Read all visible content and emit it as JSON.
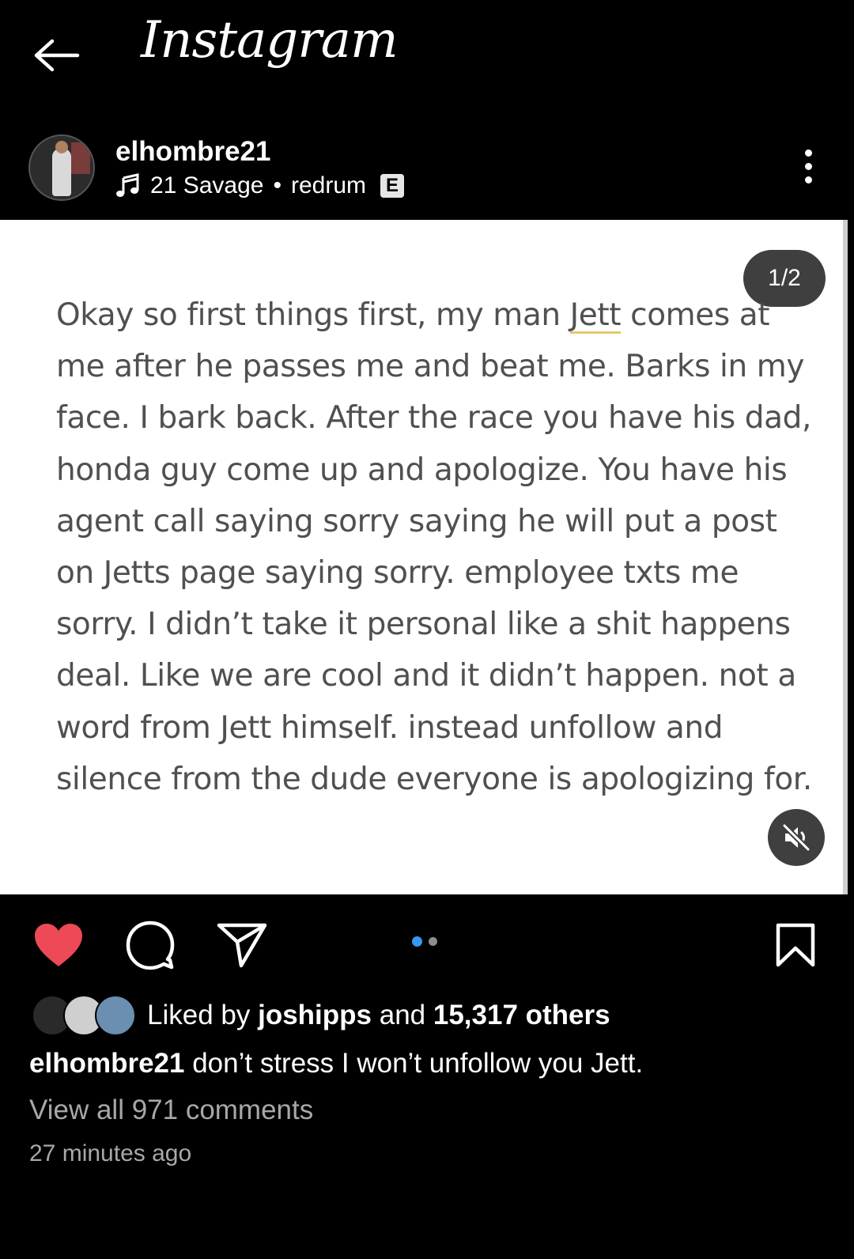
{
  "app": {
    "brand": "Instagram"
  },
  "post": {
    "username": "elhombre21",
    "music": {
      "artist": "21 Savage",
      "separator": "•",
      "track": "redrum",
      "explicit_badge": "E"
    },
    "carousel_counter": "1/2",
    "image_text": {
      "before_highlight": "Okay so first things first, my man ",
      "highlight": "Jett",
      "after_highlight": " comes at me after he passes me and beat me. Barks in my face. I bark back. After the race you have his dad, honda guy come up and apologize. You have his agent call saying sorry saying he will put a post on Jetts page saying sorry. employee txts me sorry. I didn’t take it personal like a shit happens deal. Like we are cool and it didn’t happen. not a word from Jett himself. instead unfollow and silence from the dude everyone is apologizing for."
    },
    "carousel": {
      "count": 2,
      "active": 1
    },
    "likes": {
      "prefix": "Liked by ",
      "first_liker": "joshipps",
      "and": " and ",
      "others": "15,317 others"
    },
    "caption": {
      "username": "elhombre21",
      "text": " don’t stress I won’t unfollow you Jett."
    },
    "view_comments": "View all 971 comments",
    "time_ago": "27 minutes ago"
  },
  "icons": {
    "back": "arrow-left-icon",
    "more": "more-vertical-icon",
    "music": "music-note-icon",
    "mute": "muted-speaker-icon",
    "like": "heart-icon",
    "comment": "comment-icon",
    "share": "paper-plane-icon",
    "save": "bookmark-icon"
  },
  "colors": {
    "like": "#ed4956",
    "carousel_active": "#3897f0",
    "secondary_text": "#a8a8a8"
  }
}
